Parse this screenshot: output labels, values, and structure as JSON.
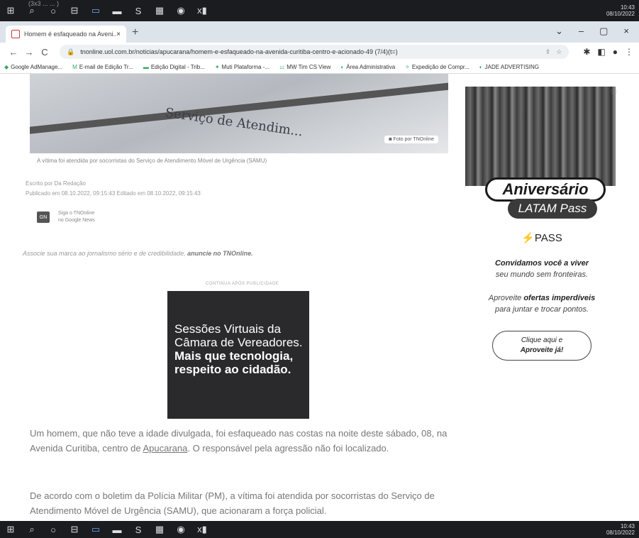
{
  "top_stub": "(3x3 ... ... )",
  "taskbar": {
    "icons": [
      "⊞",
      "⌕",
      "○",
      "⊟",
      "▭",
      "▬",
      "S",
      "▦",
      "◉",
      "x▮"
    ],
    "clock_time": "10:43",
    "clock_date": "08/10/2022"
  },
  "browser": {
    "tab_title": "Homem é esfaqueado na Aveni...",
    "tab_close": "×",
    "new_tab": "+",
    "window_controls": [
      "⌄",
      "–",
      "▢",
      "×"
    ],
    "nav_back": "←",
    "nav_forward": "→",
    "nav_reload": "C",
    "url": "tnonline.uol.com.br/noticias/apucarana/homem-e-esfaqueado-na-avenida-curitiba-centro-e-acionado-49 (7/4)(t=)",
    "bookmarks": [
      "Google AdManage...",
      "E-mail de Edição Tr...",
      "Edição Digital - Trib...",
      "Muti Plataforma -...",
      "MW Tim CS View",
      "Área Administrativa",
      "Expedição de Compr...",
      "JADE ADVERTISING"
    ]
  },
  "article": {
    "hero_sign": "Serviço de Atendim...",
    "photo_credit": "Foto por TNOnline",
    "caption": "A vítima foi atendida por socorristas do Serviço de Atendimento Móvel de Urgência (SAMU)",
    "byline_author": "Escrito por Da Redação",
    "byline_dates": "Publicado em 08.10.2022, 09:15:43    Editado em 08.10.2022, 09:15:43",
    "gnews_line1": "Siga o TNOnline",
    "gnews_line2": "no Google News",
    "gnews_logo": "GN",
    "subscribe_text": "Associe sua marca ao jornalismo sério e de credibilidade,",
    "subscribe_link": "anuncie no TNOnline.",
    "ad_label": "CONTINUA APÓS PUBLICIDADE",
    "ad_line1": "Sessões Virtuais da",
    "ad_line2": "Câmara de Vereadores.",
    "ad_line3": "Mais que tecnologia,",
    "ad_line4": "respeito ao cidadão.",
    "para1_before": "Um homem, que não teve a idade divulgada, foi esfaqueado nas costas na noite deste sábado, 08, na Avenida Curitiba, centro de ",
    "para1_link": "Apucarana",
    "para1_after": ". O responsável pela agressão não foi localizado.",
    "para2": "De acordo com o boletim da Polícia Militar (PM), a vítima foi atendida por socorristas do Serviço de Atendimento Móvel de Urgência (SAMU), que acionaram a força policial."
  },
  "side_ad": {
    "info": "ⓘ",
    "badge1": "Aniversário",
    "badge2": "LATAM Pass",
    "pass_logo": "PASS",
    "line1_bold": "Convidamos você a viver",
    "line2": "seu mundo sem fronteiras.",
    "line3_prefix": "Aproveite ",
    "line3_bold": "ofertas imperdíveis",
    "line4": "para juntar e trocar pontos.",
    "cta_line1": "Clique aqui e",
    "cta_line2": "Aproveite já!"
  }
}
